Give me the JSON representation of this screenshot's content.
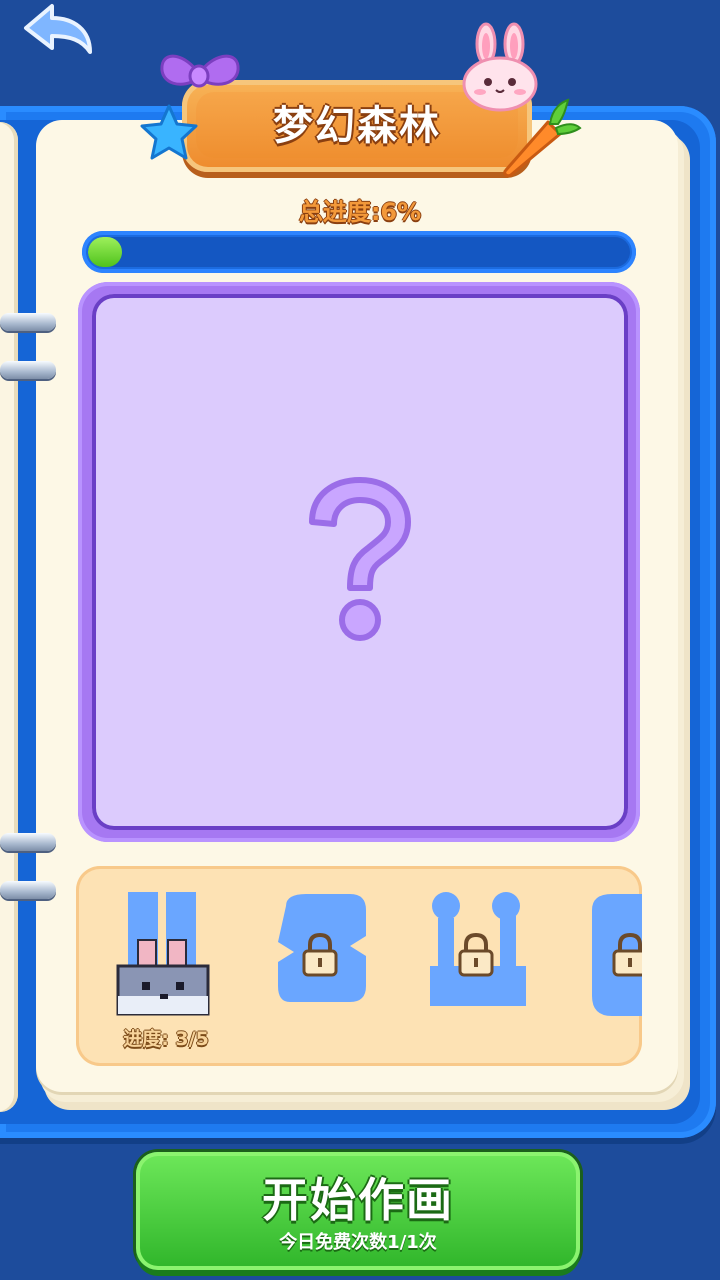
{
  "header": {
    "title": "梦幻森林"
  },
  "progress": {
    "label": "总进度:6%",
    "value": 0.06
  },
  "canvas": {
    "state": "locked",
    "icon": "question-mark-icon"
  },
  "thumbnails": [
    {
      "name": "bunny",
      "progress_text": "进度: 3/5",
      "locked": false
    },
    {
      "name": "locked-picture-2",
      "locked": true,
      "icon": "lock-icon"
    },
    {
      "name": "locked-picture-3",
      "locked": true,
      "icon": "lock-icon"
    },
    {
      "name": "locked-picture-4",
      "locked": true,
      "icon": "lock-icon"
    }
  ],
  "start_button": {
    "label": "开始作画",
    "subtitle": "今日免费次数1/1次"
  },
  "colors": {
    "background": "#1d4c9c",
    "frame": "#1e7af0",
    "plank": "#ee8a2c",
    "canvas": "#dccbfd",
    "canvas_border": "#a678f2",
    "progress_fill": "#4fc21d",
    "button": "#2fb52a",
    "thumb_silhouette": "#6aa6ff"
  }
}
